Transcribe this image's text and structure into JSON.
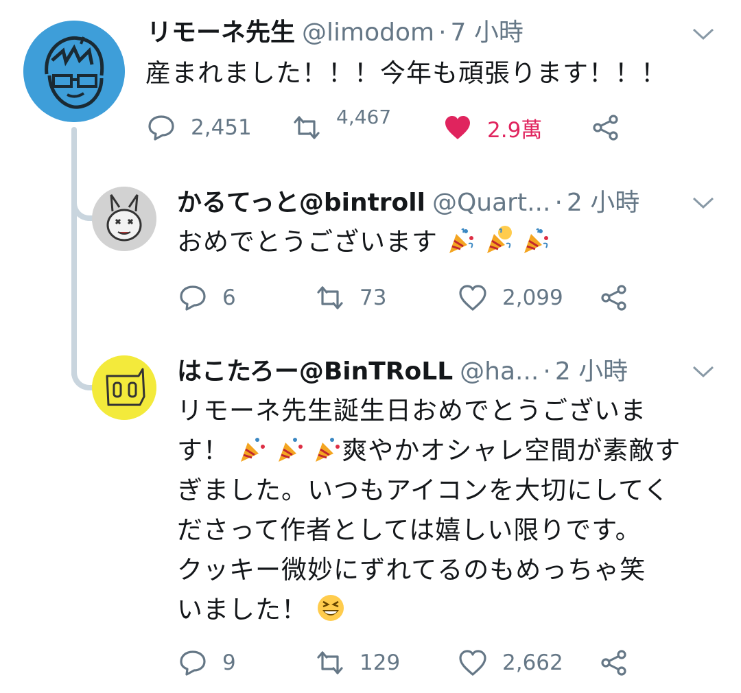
{
  "tweets": [
    {
      "display_name": "リモーネ先生",
      "handle": "@limodom",
      "dot": "·",
      "time": "7 小時",
      "text": "産まれました！！！今年も頑張ります！！！",
      "replies": "2,451",
      "retweets": "4,467",
      "likes": "2.9萬",
      "liked": true
    },
    {
      "display_name": "かるてっと@bintroll",
      "handle": "@Quart...",
      "dot": "·",
      "time": "2 小時",
      "text": "おめでとうございます",
      "emoji": [
        "party-popper",
        "party-popper",
        "party-popper"
      ],
      "replies": "6",
      "retweets": "73",
      "likes": "2,099",
      "liked": false
    },
    {
      "display_name": "はこたろー@BinTRoLL",
      "handle": "@ha...",
      "dot": "·",
      "time": "2 小時",
      "text_lines": [
        "リモーネ先生誕生日おめでとうございま",
        "す！",
        "爽やかオシャレ空間が素敵す",
        "ぎました。いつもアイコンを大切にしてく",
        "ださって作者としては嬉しい限りです。",
        "クッキー微妙にずれてるのもめっちゃ笑",
        "いました！"
      ],
      "replies": "9",
      "retweets": "129",
      "likes": "2,662",
      "liked": false
    }
  ],
  "colors": {
    "text": "#14171a",
    "secondary": "#657786",
    "like_active": "#e0245e",
    "thread_line": "#c9d5de",
    "avatar_main": "#3e9ed9",
    "avatar_yellow": "#f3ea3b"
  },
  "icons": {
    "reply": "speech-bubble-icon",
    "retweet": "retweet-arrows-icon",
    "like": "heart-icon",
    "share": "share-nodes-icon",
    "menu": "chevron-down-icon"
  }
}
